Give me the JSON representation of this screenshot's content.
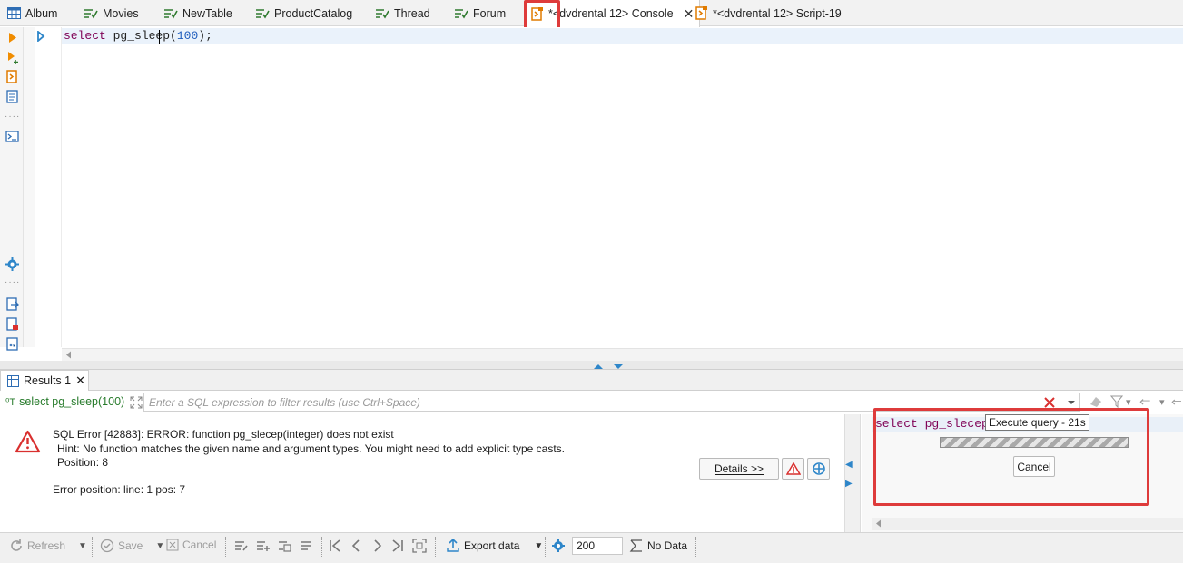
{
  "tabs": [
    {
      "label": "Album",
      "icon": "table-icon"
    },
    {
      "label": "Movies",
      "icon": "view-icon"
    },
    {
      "label": "NewTable",
      "icon": "view-icon"
    },
    {
      "label": "ProductCatalog",
      "icon": "view-icon"
    },
    {
      "label": "Thread",
      "icon": "view-icon"
    },
    {
      "label": "Forum",
      "icon": "view-icon"
    },
    {
      "label": "*<dvdrental 12> Console",
      "icon": "sql-console-icon",
      "active": true
    },
    {
      "label": "*<dvdrental 12> Script-19",
      "icon": "sql-script-icon"
    }
  ],
  "editor": {
    "keyword": "select",
    "func": "pg_sleep",
    "open": "(",
    "number": "100",
    "close": ");"
  },
  "results": {
    "tab_label": "Results 1",
    "query_label": "select pg_sleep(100)",
    "filter_placeholder": "Enter a SQL expression to filter results (use Ctrl+Space)",
    "error_message": "SQL Error [42883]: ERROR: function pg_slecep(integer) does not exist",
    "error_hint": "Hint: No function matches the given name and argument types. You might need to add explicit type casts.",
    "error_position_detail": "Position: 8",
    "error_position": "Error position: line: 1 pos: 7",
    "details_button": "Details >>"
  },
  "execution": {
    "query_snippet": "select pg_slecep",
    "tooltip": "Execute query - 21s",
    "cancel_button": "Cancel"
  },
  "bottom_toolbar": {
    "refresh": "Refresh",
    "save": "Save",
    "cancel": "Cancel",
    "export": "Export data",
    "fetch_size": "200",
    "no_data": "No Data"
  },
  "colors": {
    "highlight_border": "#de3b3b",
    "keyword": "#7f0055",
    "number": "#1f5dbd",
    "query_label": "#267a2a"
  }
}
